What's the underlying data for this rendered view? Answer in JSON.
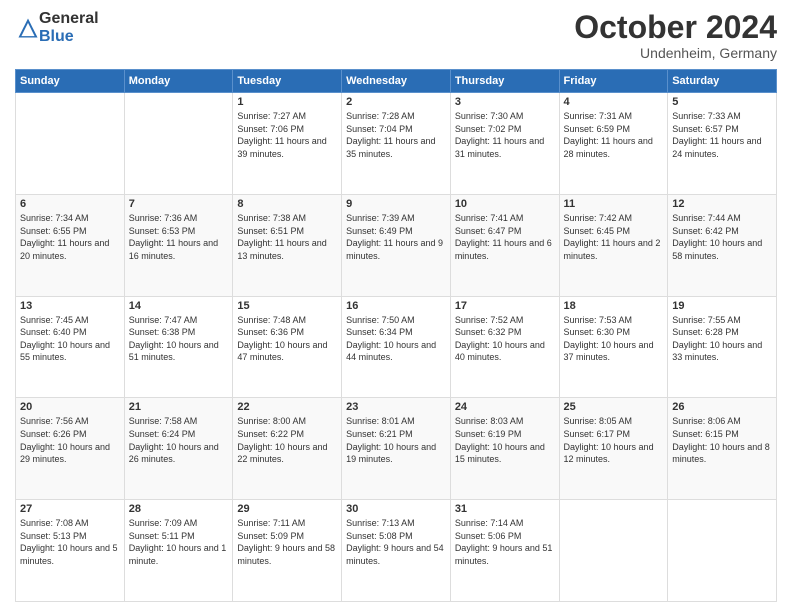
{
  "logo": {
    "general": "General",
    "blue": "Blue"
  },
  "header": {
    "month": "October 2024",
    "location": "Undenheim, Germany"
  },
  "weekdays": [
    "Sunday",
    "Monday",
    "Tuesday",
    "Wednesday",
    "Thursday",
    "Friday",
    "Saturday"
  ],
  "weeks": [
    [
      {
        "day": null,
        "info": null
      },
      {
        "day": null,
        "info": null
      },
      {
        "day": "1",
        "info": "Sunrise: 7:27 AM\nSunset: 7:06 PM\nDaylight: 11 hours and 39 minutes."
      },
      {
        "day": "2",
        "info": "Sunrise: 7:28 AM\nSunset: 7:04 PM\nDaylight: 11 hours and 35 minutes."
      },
      {
        "day": "3",
        "info": "Sunrise: 7:30 AM\nSunset: 7:02 PM\nDaylight: 11 hours and 31 minutes."
      },
      {
        "day": "4",
        "info": "Sunrise: 7:31 AM\nSunset: 6:59 PM\nDaylight: 11 hours and 28 minutes."
      },
      {
        "day": "5",
        "info": "Sunrise: 7:33 AM\nSunset: 6:57 PM\nDaylight: 11 hours and 24 minutes."
      }
    ],
    [
      {
        "day": "6",
        "info": "Sunrise: 7:34 AM\nSunset: 6:55 PM\nDaylight: 11 hours and 20 minutes."
      },
      {
        "day": "7",
        "info": "Sunrise: 7:36 AM\nSunset: 6:53 PM\nDaylight: 11 hours and 16 minutes."
      },
      {
        "day": "8",
        "info": "Sunrise: 7:38 AM\nSunset: 6:51 PM\nDaylight: 11 hours and 13 minutes."
      },
      {
        "day": "9",
        "info": "Sunrise: 7:39 AM\nSunset: 6:49 PM\nDaylight: 11 hours and 9 minutes."
      },
      {
        "day": "10",
        "info": "Sunrise: 7:41 AM\nSunset: 6:47 PM\nDaylight: 11 hours and 6 minutes."
      },
      {
        "day": "11",
        "info": "Sunrise: 7:42 AM\nSunset: 6:45 PM\nDaylight: 11 hours and 2 minutes."
      },
      {
        "day": "12",
        "info": "Sunrise: 7:44 AM\nSunset: 6:42 PM\nDaylight: 10 hours and 58 minutes."
      }
    ],
    [
      {
        "day": "13",
        "info": "Sunrise: 7:45 AM\nSunset: 6:40 PM\nDaylight: 10 hours and 55 minutes."
      },
      {
        "day": "14",
        "info": "Sunrise: 7:47 AM\nSunset: 6:38 PM\nDaylight: 10 hours and 51 minutes."
      },
      {
        "day": "15",
        "info": "Sunrise: 7:48 AM\nSunset: 6:36 PM\nDaylight: 10 hours and 47 minutes."
      },
      {
        "day": "16",
        "info": "Sunrise: 7:50 AM\nSunset: 6:34 PM\nDaylight: 10 hours and 44 minutes."
      },
      {
        "day": "17",
        "info": "Sunrise: 7:52 AM\nSunset: 6:32 PM\nDaylight: 10 hours and 40 minutes."
      },
      {
        "day": "18",
        "info": "Sunrise: 7:53 AM\nSunset: 6:30 PM\nDaylight: 10 hours and 37 minutes."
      },
      {
        "day": "19",
        "info": "Sunrise: 7:55 AM\nSunset: 6:28 PM\nDaylight: 10 hours and 33 minutes."
      }
    ],
    [
      {
        "day": "20",
        "info": "Sunrise: 7:56 AM\nSunset: 6:26 PM\nDaylight: 10 hours and 29 minutes."
      },
      {
        "day": "21",
        "info": "Sunrise: 7:58 AM\nSunset: 6:24 PM\nDaylight: 10 hours and 26 minutes."
      },
      {
        "day": "22",
        "info": "Sunrise: 8:00 AM\nSunset: 6:22 PM\nDaylight: 10 hours and 22 minutes."
      },
      {
        "day": "23",
        "info": "Sunrise: 8:01 AM\nSunset: 6:21 PM\nDaylight: 10 hours and 19 minutes."
      },
      {
        "day": "24",
        "info": "Sunrise: 8:03 AM\nSunset: 6:19 PM\nDaylight: 10 hours and 15 minutes."
      },
      {
        "day": "25",
        "info": "Sunrise: 8:05 AM\nSunset: 6:17 PM\nDaylight: 10 hours and 12 minutes."
      },
      {
        "day": "26",
        "info": "Sunrise: 8:06 AM\nSunset: 6:15 PM\nDaylight: 10 hours and 8 minutes."
      }
    ],
    [
      {
        "day": "27",
        "info": "Sunrise: 7:08 AM\nSunset: 5:13 PM\nDaylight: 10 hours and 5 minutes."
      },
      {
        "day": "28",
        "info": "Sunrise: 7:09 AM\nSunset: 5:11 PM\nDaylight: 10 hours and 1 minute."
      },
      {
        "day": "29",
        "info": "Sunrise: 7:11 AM\nSunset: 5:09 PM\nDaylight: 9 hours and 58 minutes."
      },
      {
        "day": "30",
        "info": "Sunrise: 7:13 AM\nSunset: 5:08 PM\nDaylight: 9 hours and 54 minutes."
      },
      {
        "day": "31",
        "info": "Sunrise: 7:14 AM\nSunset: 5:06 PM\nDaylight: 9 hours and 51 minutes."
      },
      {
        "day": null,
        "info": null
      },
      {
        "day": null,
        "info": null
      }
    ]
  ]
}
